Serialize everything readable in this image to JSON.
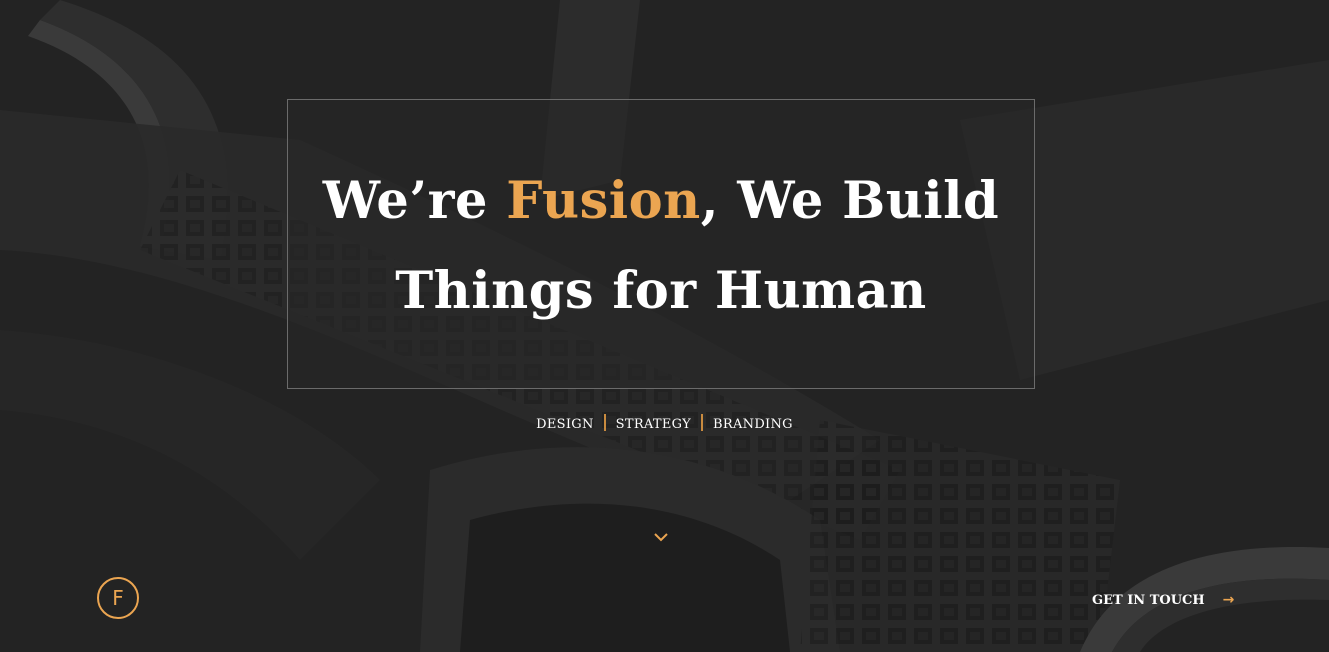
{
  "hero": {
    "headline_part1": "We’re ",
    "headline_accent": "Fusion",
    "headline_part2": ", We Build",
    "headline_line2": "Things for Human",
    "accent_color": "#eba551"
  },
  "services": {
    "items": [
      "DESIGN",
      "STRATEGY",
      "BRANDING"
    ]
  },
  "scroll": {
    "icon": "chevron-down-icon"
  },
  "logo": {
    "letter": "F"
  },
  "cta": {
    "label": "GET IN TOUCH",
    "icon": "arrow-right-icon"
  }
}
